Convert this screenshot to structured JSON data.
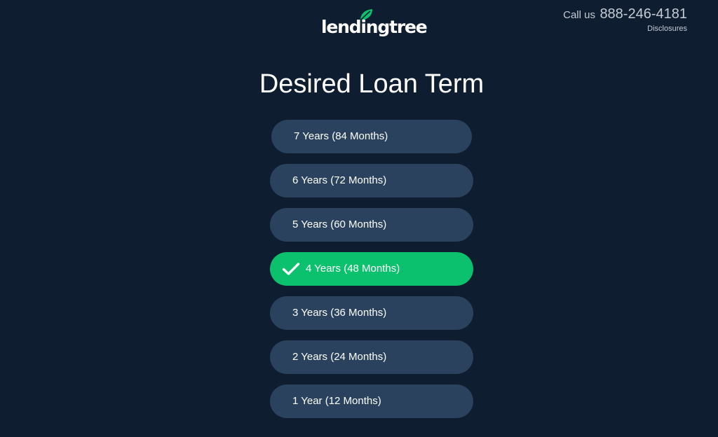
{
  "header": {
    "logo_text": "lendingtree",
    "call_us_label": "Call us",
    "phone": "888-246-4181",
    "disclosures": "Disclosures"
  },
  "page": {
    "title": "Desired Loan Term"
  },
  "loan_terms": {
    "options": [
      {
        "label": "7 Years (84 Months)",
        "selected": false
      },
      {
        "label": "6 Years (72 Months)",
        "selected": false
      },
      {
        "label": "5 Years (60 Months)",
        "selected": false
      },
      {
        "label": "4 Years (48 Months)",
        "selected": true
      },
      {
        "label": "3 Years (36 Months)",
        "selected": false
      },
      {
        "label": "2 Years (24 Months)",
        "selected": false
      },
      {
        "label": "1 Year (12 Months)",
        "selected": false
      }
    ]
  },
  "colors": {
    "background": "#0f1d30",
    "option": "#2a425e",
    "selected": "#0cc16e",
    "logo_leaf": "#0cc16e"
  },
  "icons": {
    "logo": "leaf-icon",
    "selected_marker": "check-icon"
  }
}
